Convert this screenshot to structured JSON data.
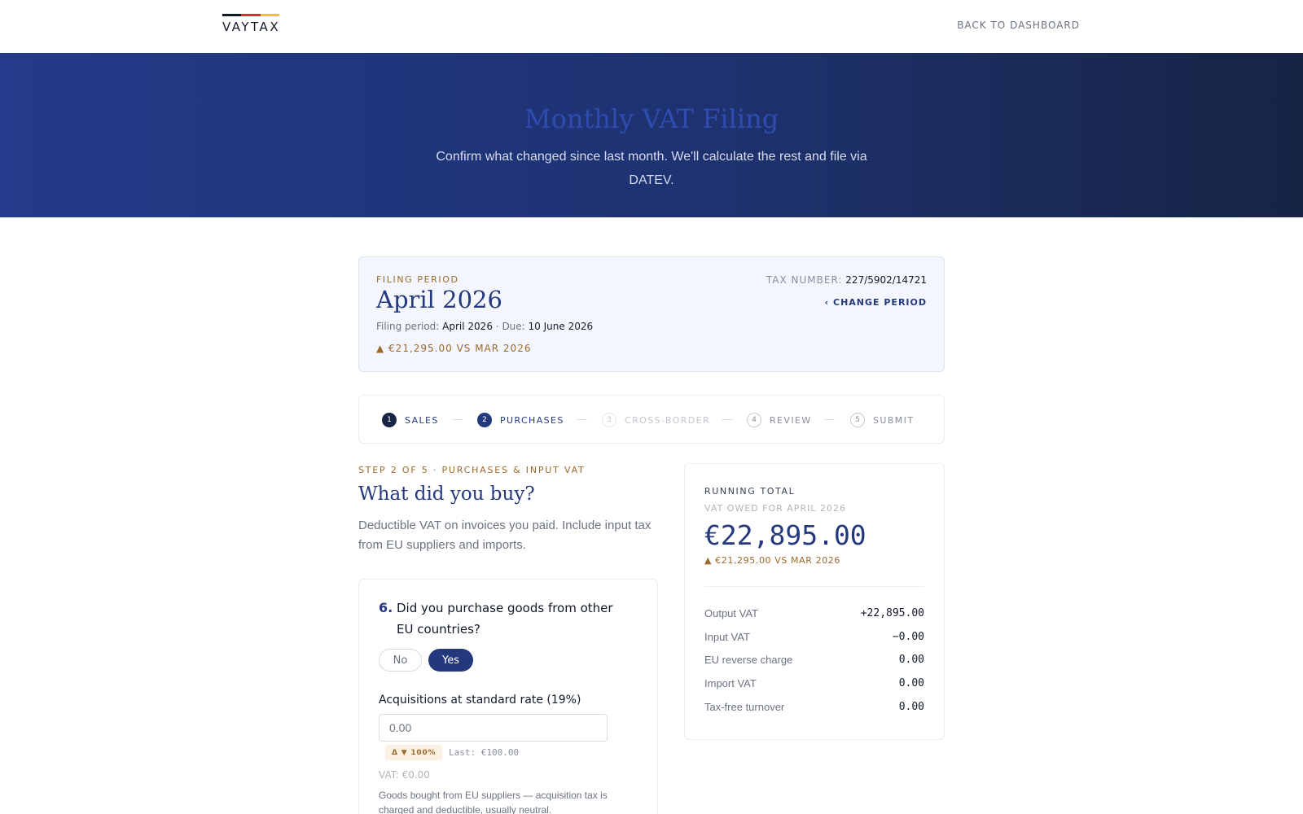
{
  "brand": {
    "name": "VAYTAX",
    "stripe_colors": [
      "#111827",
      "#d62f2f",
      "#f2c230"
    ]
  },
  "nav": {
    "back_label": "BACK TO DASHBOARD"
  },
  "hero": {
    "title": "Monthly VAT Filing",
    "subtitle": "Confirm what changed since last month. We'll calculate the rest and file via DATEV."
  },
  "period": {
    "eyebrow": "FILING PERIOD",
    "title": "April 2026",
    "meta_period_label": "Filing period:",
    "meta_period_value": "April 2026",
    "meta_sep": "·",
    "meta_due_label": "Due:",
    "meta_due_value": "10 June 2026",
    "delta": "▲ €21,295.00 VS MAR 2026",
    "tax_number_label": "TAX NUMBER:",
    "tax_number_value": "227/5902/14721",
    "change_label": "‹ CHANGE PERIOD"
  },
  "steps": [
    {
      "num": "1",
      "label": "SALES",
      "state": "done"
    },
    {
      "num": "2",
      "label": "PURCHASES",
      "state": "active"
    },
    {
      "num": "3",
      "label": "CROSS-BORDER",
      "state": "disabled"
    },
    {
      "num": "4",
      "label": "REVIEW",
      "state": "pending"
    },
    {
      "num": "5",
      "label": "SUBMIT",
      "state": "pending"
    }
  ],
  "main": {
    "eyebrow": "STEP 2 OF 5 · PURCHASES & INPUT VAT",
    "title": "What did you buy?",
    "description": "Deductible VAT on invoices you paid. Include input tax from EU suppliers and imports."
  },
  "question": {
    "number": "6.",
    "text": "Did you purchase goods from other EU countries?",
    "option_no": "No",
    "option_yes": "Yes",
    "selected": "Yes",
    "field_label": "Acquisitions at standard rate (19%)",
    "field_value": "0.00",
    "delta_badge": "Δ ▼ 100%",
    "last_value": "Last: €100.00",
    "vat_value": "VAT: €0.00",
    "help_text": "Goods bought from EU suppliers — acquisition tax is charged and deductible, usually neutral."
  },
  "running_total": {
    "eyebrow": "RUNNING TOTAL",
    "subtitle": "VAT OWED FOR APRIL 2026",
    "amount": "€22,895.00",
    "delta": "▲ €21,295.00 VS MAR 2026",
    "rows": [
      {
        "label": "Output VAT",
        "value": "+22,895.00"
      },
      {
        "label": "Input VAT",
        "value": "−0.00"
      },
      {
        "label": "EU reverse charge",
        "value": "0.00"
      },
      {
        "label": "Import VAT",
        "value": "0.00"
      },
      {
        "label": "Tax-free turnover",
        "value": "0.00"
      }
    ]
  },
  "colors": {
    "primary": "#24387e",
    "accent_gold": "#9a6a2c",
    "hero_start": "#233b8a",
    "hero_end": "#172444"
  }
}
